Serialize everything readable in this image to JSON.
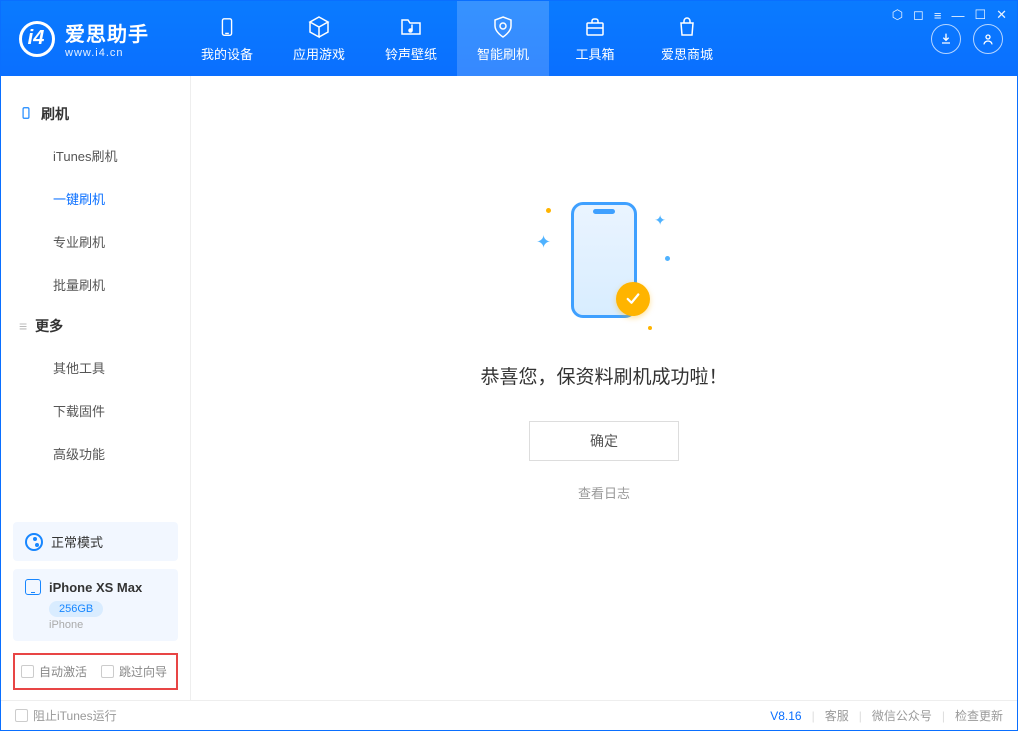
{
  "app": {
    "name": "爱思助手",
    "url": "www.i4.cn"
  },
  "tabs": {
    "device": "我的设备",
    "apps": "应用游戏",
    "ringtone": "铃声壁纸",
    "flash": "智能刷机",
    "toolbox": "工具箱",
    "store": "爱思商城"
  },
  "sidebar": {
    "section_flash": "刷机",
    "items_flash": {
      "itunes": "iTunes刷机",
      "oneclick": "一键刷机",
      "pro": "专业刷机",
      "batch": "批量刷机"
    },
    "section_more": "更多",
    "items_more": {
      "other": "其他工具",
      "firmware": "下载固件",
      "advanced": "高级功能"
    }
  },
  "mode": {
    "label": "正常模式"
  },
  "device": {
    "name": "iPhone XS Max",
    "storage": "256GB",
    "type": "iPhone"
  },
  "options": {
    "auto_activate": "自动激活",
    "skip_guide": "跳过向导"
  },
  "main": {
    "message": "恭喜您，保资料刷机成功啦！",
    "ok": "确定",
    "view_log": "查看日志"
  },
  "footer": {
    "block_itunes": "阻止iTunes运行",
    "version": "V8.16",
    "support": "客服",
    "wechat": "微信公众号",
    "check_update": "检查更新"
  }
}
